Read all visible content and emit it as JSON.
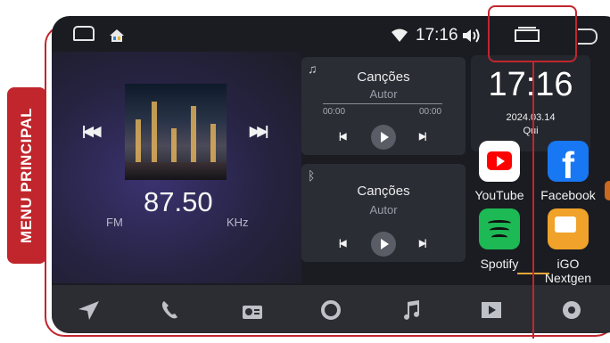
{
  "side_label": "MENU PRINCIPAL",
  "status": {
    "time": "17:16"
  },
  "radio": {
    "frequency": "87.50",
    "band": "FM",
    "unit": "KHz"
  },
  "music_card": {
    "title": "Canções",
    "artist": "Autor",
    "time_start": "00:00",
    "time_end": "00:00"
  },
  "bt_card": {
    "title": "Canções",
    "artist": "Autor"
  },
  "clock": {
    "time": "17:16",
    "date": "2024.03.14",
    "weekday": "Qui"
  },
  "apps": [
    {
      "label": "YouTube",
      "icon": "youtube-icon",
      "color": "#ffffff"
    },
    {
      "label": "Facebook",
      "icon": "facebook-icon",
      "color": "#1877f2"
    },
    {
      "label": "Spotify",
      "icon": "spotify-icon",
      "color": "#1db954"
    },
    {
      "label": "iGO Nextgen",
      "icon": "igo-icon",
      "color": "#f0a22a"
    }
  ],
  "dock": [
    "navigation-icon",
    "phone-icon",
    "radio-icon",
    "circle-icon",
    "music-icon",
    "video-icon",
    "settings-icon"
  ],
  "accent": "#c0262d"
}
